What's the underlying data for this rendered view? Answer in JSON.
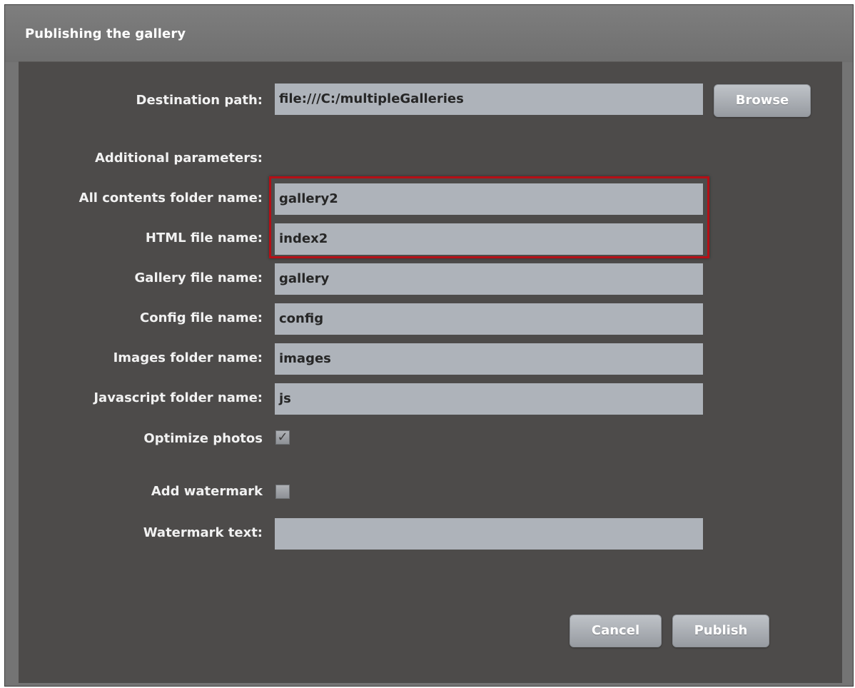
{
  "dialog": {
    "title": "Publishing the gallery"
  },
  "form": {
    "destination": {
      "label": "Destination path:",
      "value": "file:///C:/multipleGalleries"
    },
    "browse_label": "Browse",
    "additional_label": "Additional parameters:",
    "all_contents": {
      "label": "All contents folder name:",
      "value": "gallery2"
    },
    "html_file": {
      "label": "HTML file name:",
      "value": "index2"
    },
    "gallery_file": {
      "label": "Gallery file name:",
      "value": "gallery"
    },
    "config_file": {
      "label": "Config file name:",
      "value": "config"
    },
    "images_folder": {
      "label": "Images folder name:",
      "value": "images"
    },
    "js_folder": {
      "label": "Javascript folder name:",
      "value": "js"
    },
    "optimize": {
      "label": "Optimize photos",
      "checked": true,
      "mark": "✓"
    },
    "watermark": {
      "label": "Add watermark",
      "checked": false
    },
    "watermark_text": {
      "label": "Watermark text:",
      "value": ""
    }
  },
  "buttons": {
    "cancel": "Cancel",
    "publish": "Publish"
  },
  "colors": {
    "highlight": "#b50f16",
    "panel": "#4d4b4a",
    "field": "#aeb3ba"
  }
}
